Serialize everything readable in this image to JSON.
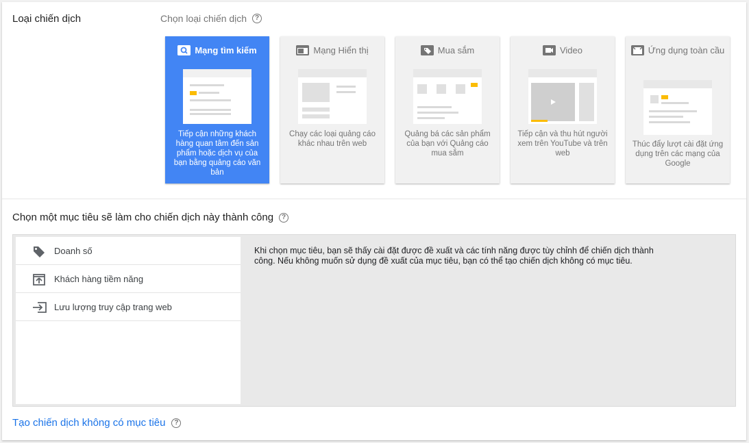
{
  "campaign_type": {
    "label": "Loại chiến dịch",
    "subtitle": "Chọn loại chiến dịch",
    "cards": [
      {
        "title": "Mạng tìm kiếm",
        "desc": "Tiếp cận những khách hàng quan tâm đến sản phẩm hoặc dịch vụ của bạn bằng quảng cáo văn bản",
        "icon": "search-icon",
        "selected": true
      },
      {
        "title": "Mạng Hiển thị",
        "desc": "Chạy các loại quảng cáo khác nhau trên web",
        "icon": "display-icon",
        "selected": false
      },
      {
        "title": "Mua sắm",
        "desc": "Quảng bá các sản phẩm của bạn với Quảng cáo mua sắm",
        "icon": "tag-icon",
        "selected": false
      },
      {
        "title": "Video",
        "desc": "Tiếp cận và thu hút người xem trên YouTube và trên web",
        "icon": "video-icon",
        "selected": false
      },
      {
        "title": "Ứng dụng toàn cầu",
        "desc": "Thúc đẩy lượt cài đặt ứng dụng trên các mạng của Google",
        "icon": "app-icon",
        "selected": false
      }
    ]
  },
  "goal": {
    "label": "Chọn một mục tiêu sẽ làm cho chiến dịch này thành công",
    "items": [
      {
        "label": "Doanh số",
        "icon": "tag-icon"
      },
      {
        "label": "Khách hàng tiềm năng",
        "icon": "lead-upload-icon"
      },
      {
        "label": "Lưu lượng truy cập trang web",
        "icon": "enter-arrow-icon"
      }
    ],
    "info": "Khi chọn mục tiêu, bạn sẽ thấy cài đặt được đề xuất và các tính năng được tùy chỉnh để chiến dịch thành công. Nếu không muốn sử dụng đề xuất của mục tiêu, bạn có thể tạo chiến dịch không có mục tiêu."
  },
  "no_goal_link": "Tạo chiến dịch không có mục tiêu",
  "colors": {
    "selected": "#4285f4",
    "link": "#1a73e8",
    "accent": "#fbbc04"
  }
}
